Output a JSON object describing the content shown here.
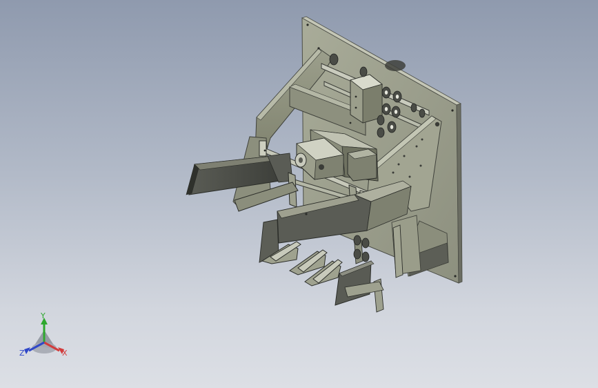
{
  "viewport": {
    "background_top": "#8f9aae",
    "background_bottom": "#dcdfe5"
  },
  "triad": {
    "x_label": "X",
    "y_label": "Y",
    "z_label": "Z",
    "x_color": "#d23c3c",
    "y_color": "#2ea82e",
    "z_color": "#2f47c8"
  },
  "model": {
    "icon": "3d-cad-assembly",
    "part_color": "#8f9280",
    "plate_color": "#a7aa98",
    "dark_color": "#4e504a"
  }
}
